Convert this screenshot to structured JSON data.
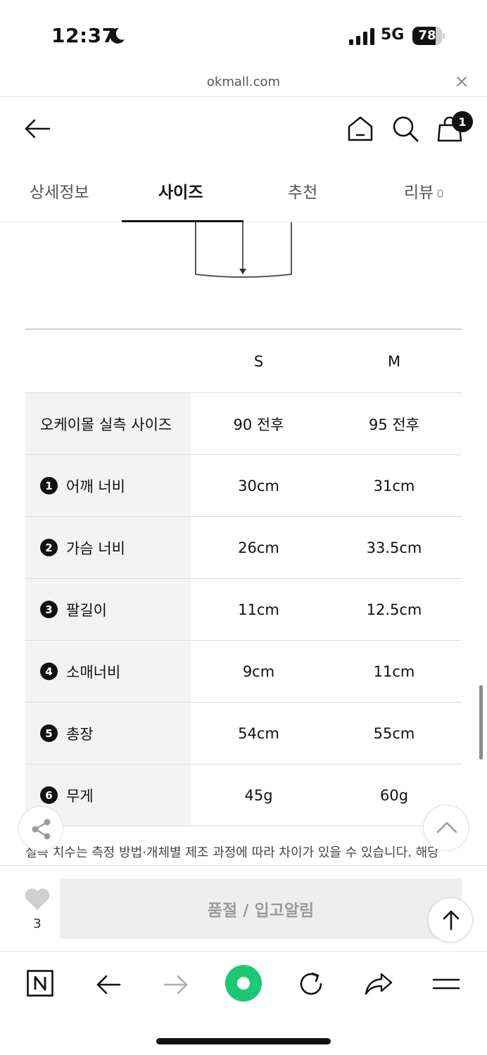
{
  "status_bar": {
    "time": "12:37",
    "network": "5G",
    "battery": "78",
    "battery_level": 0.78
  },
  "browser": {
    "url": "okmall.com"
  },
  "header": {
    "cart_count": "1"
  },
  "tabs": [
    {
      "label": "상세정보"
    },
    {
      "label": "사이즈"
    },
    {
      "label": "추천"
    },
    {
      "label": "리뷰",
      "count": "0"
    }
  ],
  "size_table": {
    "columns": [
      "S",
      "M"
    ],
    "rows": [
      {
        "num": "",
        "label": "오케이몰 실측 사이즈",
        "values": [
          "90 전후",
          "95 전후"
        ]
      },
      {
        "num": "1",
        "label": "어깨 너비",
        "values": [
          "30cm",
          "31cm"
        ]
      },
      {
        "num": "2",
        "label": "가슴 너비",
        "values": [
          "26cm",
          "33.5cm"
        ]
      },
      {
        "num": "3",
        "label": "팔길이",
        "values": [
          "11cm",
          "12.5cm"
        ]
      },
      {
        "num": "4",
        "label": "소매너비",
        "values": [
          "9cm",
          "11cm"
        ]
      },
      {
        "num": "5",
        "label": "총장",
        "values": [
          "54cm",
          "55cm"
        ]
      },
      {
        "num": "6",
        "label": "무게",
        "values": [
          "45g",
          "60g"
        ]
      }
    ]
  },
  "note": "실측 치수는 측정 방법·개체별 제조 과정에 따라 차이가 있을 수 있습니다. 해당",
  "buy_bar": {
    "like_count": "3",
    "button_label": "품절 / 입고알림"
  },
  "colors": {
    "accent_green": "#1ec773",
    "soldout_bg": "#eeeeee",
    "table_label_bg": "#f3f3f3"
  }
}
